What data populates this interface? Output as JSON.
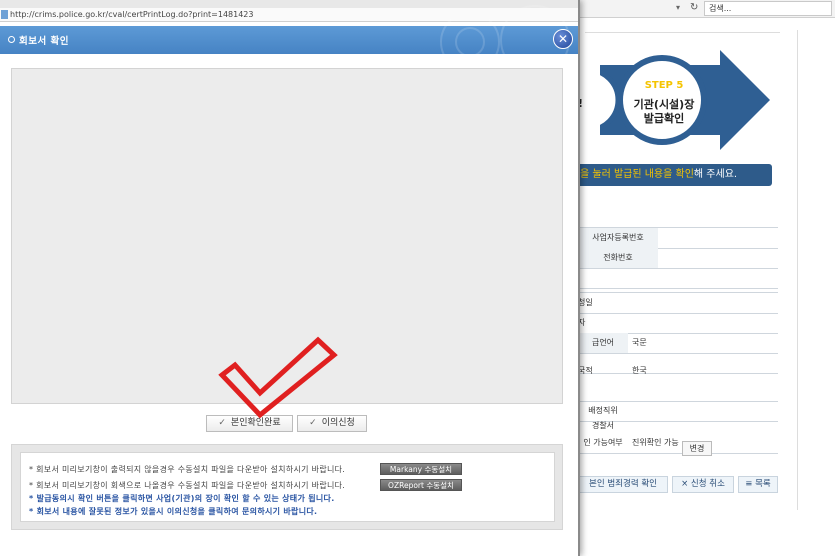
{
  "browser_bg": {
    "search_placeholder": "검색...",
    "step": {
      "label": "STEP 5",
      "title_line1": "기관(시설)장",
      "title_line2": "발급확인",
      "prev_fragment": "!"
    },
    "banner": {
      "highlight": "을 눌러 발급된 내용을 확인",
      "suffix": "해 주세요."
    },
    "rows": [
      {
        "label": "사업자등록번호",
        "value": ""
      },
      {
        "label": "전화번호",
        "value": ""
      },
      {
        "label": "",
        "value": ""
      },
      {
        "label": "청일자",
        "value": ""
      },
      {
        "label": "",
        "value": ""
      },
      {
        "label": "급언어",
        "value": "국문"
      },
      {
        "label": "",
        "value": ""
      },
      {
        "label": "국적",
        "value": "한국"
      },
      {
        "label": "",
        "value": ""
      },
      {
        "label": "배정직위",
        "value": ""
      },
      {
        "label": "경찰서",
        "value": ""
      },
      {
        "label": "인 가능여부",
        "value": "진위확인 가능"
      }
    ],
    "change_button": "변경",
    "buttons": {
      "confirm": "본인 범죄경력 확인",
      "cancel": "× 신청 취소",
      "list": "≡ 목록"
    }
  },
  "popup": {
    "address": "http://crims.police.go.kr/cval/certPrintLog.do?print=1481423",
    "title": "회보서 확인",
    "buttons": {
      "confirm_label": "본인확인완료",
      "objection_label": "이의신청"
    },
    "notices": [
      {
        "text": "* 회보서 미리보기창이 출력되지 않을경우 수동설치 파일을 다운받아 설치하시기 바랍니다.",
        "button": "Markany 수동설치",
        "style": "gray"
      },
      {
        "text": "* 회보서 미리보기창이 회색으로 나올경우 수동설치 파일을 다운받아 설치하시기 바랍니다.",
        "button": "OZReport 수동설치",
        "style": "gray"
      },
      {
        "text": "* 발급동의시 확인 버튼을 클릭하면 사업(기관)의 장이 확인 할 수 있는 상태가 됩니다.",
        "style": "blue"
      },
      {
        "text": "* 회보서 내용에 잘못된 정보가 있을시 이의신청을 클릭하여 문의하시기 바랍니다.",
        "style": "blue"
      }
    ]
  },
  "colors": {
    "header_blue": "#4683c4",
    "banner_navy": "#2e5b8a",
    "highlight_yellow": "#f5c400",
    "annotation_red": "#e02020"
  }
}
